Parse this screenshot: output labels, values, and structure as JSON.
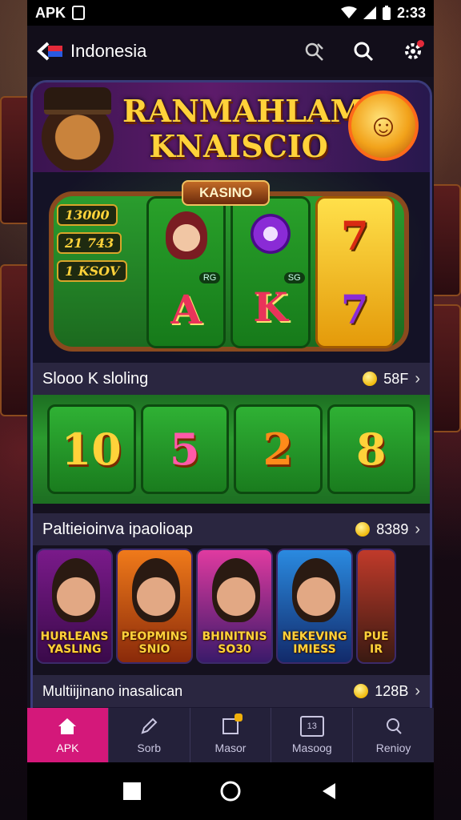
{
  "status_bar": {
    "left_text": "APK",
    "time": "2:33"
  },
  "header": {
    "title": "Indonesia"
  },
  "banner": {
    "title_line1": "RANMAHLAMIX",
    "title_line2": "KNAISCIO"
  },
  "hero": {
    "tag": "KASINO",
    "chips": [
      "13000",
      "21 743",
      "1 KSOV"
    ],
    "reel_symbols": [
      "A",
      "K",
      "7",
      "7"
    ],
    "mini_labels": [
      "RG",
      "SG"
    ]
  },
  "sections": [
    {
      "title": "Slooo K sloling",
      "count": "58F"
    },
    {
      "title": "Paltieioinva ipaolioap",
      "count": "8389"
    },
    {
      "title": "Multiijinano inasalican",
      "count": "128B"
    }
  ],
  "number_reels": [
    "10",
    "5",
    "2",
    "8"
  ],
  "game_cards": [
    {
      "caption_line1": "HURLEANS",
      "caption_line2": "YASLING"
    },
    {
      "caption_line1": "PEOPMINS",
      "caption_line2": "SNIO"
    },
    {
      "caption_line1": "BHINITNIS",
      "caption_line2": "SO30"
    },
    {
      "caption_line1": "NEKEVING",
      "caption_line2": "IMIESS"
    },
    {
      "caption_line1": "PUE",
      "caption_line2": "IR"
    }
  ],
  "bottom_nav": [
    {
      "label": "APK",
      "active": true
    },
    {
      "label": "Sorb",
      "active": false
    },
    {
      "label": "Masor",
      "active": false
    },
    {
      "label": "Masoog",
      "active": false
    },
    {
      "label": "Renioy",
      "active": false
    }
  ],
  "nav_badges": {
    "masor_box_text": "",
    "masoog_box_text": "13"
  },
  "colors": {
    "accent": "#d4187a",
    "gold": "#ffd23a",
    "table_green": "#2a9d2e"
  }
}
